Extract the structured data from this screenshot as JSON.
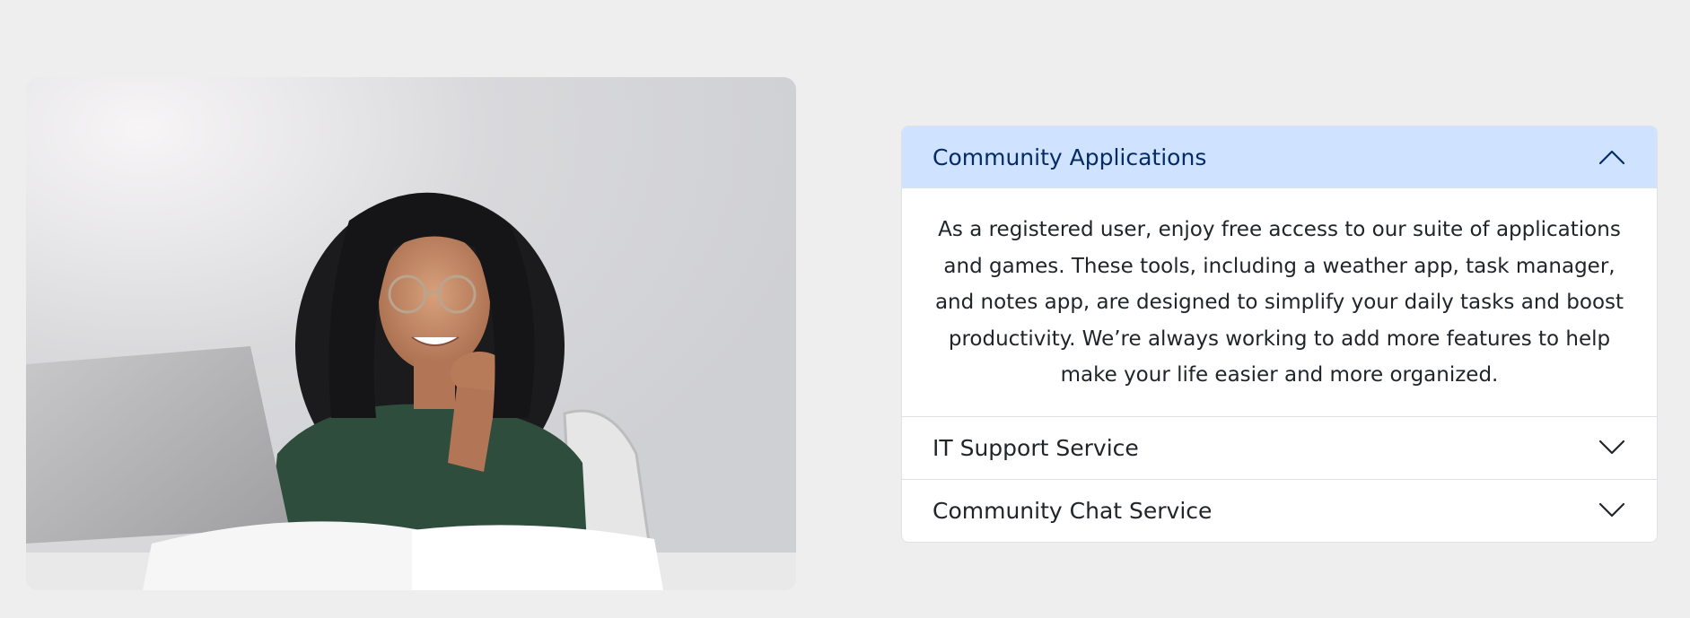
{
  "image": {
    "alt": "Smiling woman with glasses sitting at a laptop"
  },
  "accordion": {
    "items": [
      {
        "title": "Community Applications",
        "expanded": true,
        "icon": "chevron-up-icon",
        "body": "As a registered user, enjoy free access to our suite of applications and games. These tools, including a weather app, task manager, and notes app, are designed to simplify your daily tasks and boost productivity. We’re always working to add more features to help make your life easier and more organized."
      },
      {
        "title": "IT Support Service",
        "expanded": false,
        "icon": "chevron-down-icon"
      },
      {
        "title": "Community Chat Service",
        "expanded": false,
        "icon": "chevron-down-icon"
      }
    ]
  },
  "colors": {
    "page_background": "#eeeeee",
    "active_header_background": "#cfe2ff",
    "active_header_text": "#052c65",
    "border": "#dee2e6"
  }
}
